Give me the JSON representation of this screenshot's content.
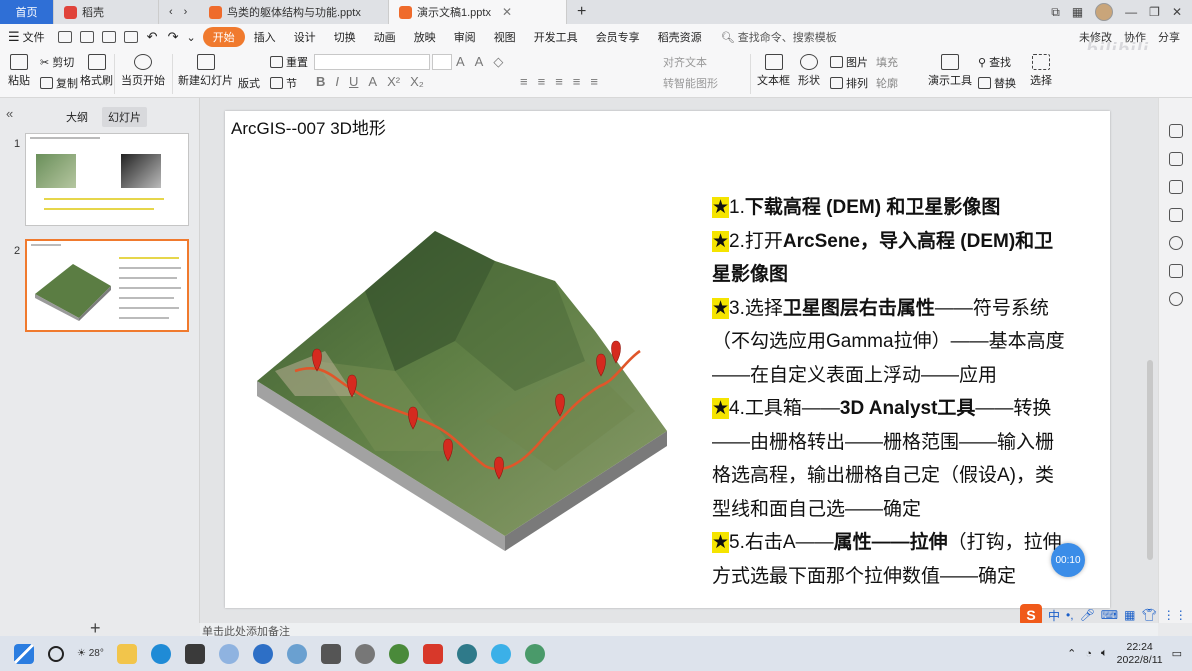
{
  "tabs": [
    {
      "label": "首页"
    },
    {
      "label": "稻壳"
    },
    {
      "label": "鸟类的躯体结构与功能.pptx"
    },
    {
      "label": "演示文稿1.pptx"
    }
  ],
  "menu": {
    "file": "文件",
    "start": "开始",
    "items": [
      "插入",
      "设计",
      "切换",
      "动画",
      "放映",
      "审阅",
      "视图",
      "开发工具",
      "会员专享",
      "稻壳资源"
    ],
    "search": "查找命令、搜索模板",
    "right": [
      "未修改",
      "协作",
      "分享"
    ]
  },
  "ribbon": {
    "paste": "粘贴",
    "cut": "剪切",
    "copy": "复制",
    "format_painter": "格式刷",
    "from_current": "当页开始",
    "new_slide": "新建幻灯片",
    "layout": "版式",
    "section": "节",
    "reset": "重置",
    "align_text": "对齐文本",
    "smart_art": "转智能图形",
    "textbox": "文本框",
    "shape": "形状",
    "arrange": "排列",
    "picture": "图片",
    "fill": "填充",
    "outline": "轮廓",
    "presentation_tools": "演示工具",
    "find": "查找",
    "replace": "替换",
    "select": "选择"
  },
  "leftpane": {
    "outline_tab": "大纲",
    "slides_tab": "幻灯片",
    "slide_numbers": [
      "1",
      "2"
    ]
  },
  "slide": {
    "title": "ArcGIS--007   3D地形",
    "lines": [
      {
        "star": "★",
        "parts": [
          {
            "t": "1.",
            "b": false
          },
          {
            "t": "下载高程 (DEM) 和卫星影像图",
            "b": true
          }
        ]
      },
      {
        "star": "★",
        "parts": [
          {
            "t": "2.打开",
            "b": false
          },
          {
            "t": "ArcSene，导入高程 (DEM)和卫星影像图",
            "b": true
          }
        ]
      },
      {
        "star": "★",
        "parts": [
          {
            "t": "3.选择",
            "b": false
          },
          {
            "t": "卫星图层右击属性",
            "b": true
          },
          {
            "t": "——符号系统（不勾选应用Gamma拉伸）——基本高度——在自定义表面上浮动——应用",
            "b": false
          }
        ]
      },
      {
        "star": "★",
        "parts": [
          {
            "t": "4.工具箱——",
            "b": false
          },
          {
            "t": "3D Analyst工具",
            "b": true
          },
          {
            "t": "——转换——由栅格转出——栅格范围——输入栅格选高程，输出栅格自己定（假设A)，类型线和面自己选——确定",
            "b": false
          }
        ]
      },
      {
        "star": "★",
        "parts": [
          {
            "t": "5.右击A——",
            "b": false
          },
          {
            "t": "属性——拉伸",
            "b": true
          },
          {
            "t": "（打钩，拉伸方式选最下面那个拉伸数值——确定",
            "b": false
          }
        ]
      }
    ]
  },
  "notes_placeholder": "单击此处添加备注",
  "timer": "00:10",
  "weather": "28°",
  "ime": {
    "lang": "中",
    "punct": "•,"
  },
  "clock": {
    "time": "22:24",
    "date": "2022/8/11"
  },
  "watermark": "bilibili"
}
